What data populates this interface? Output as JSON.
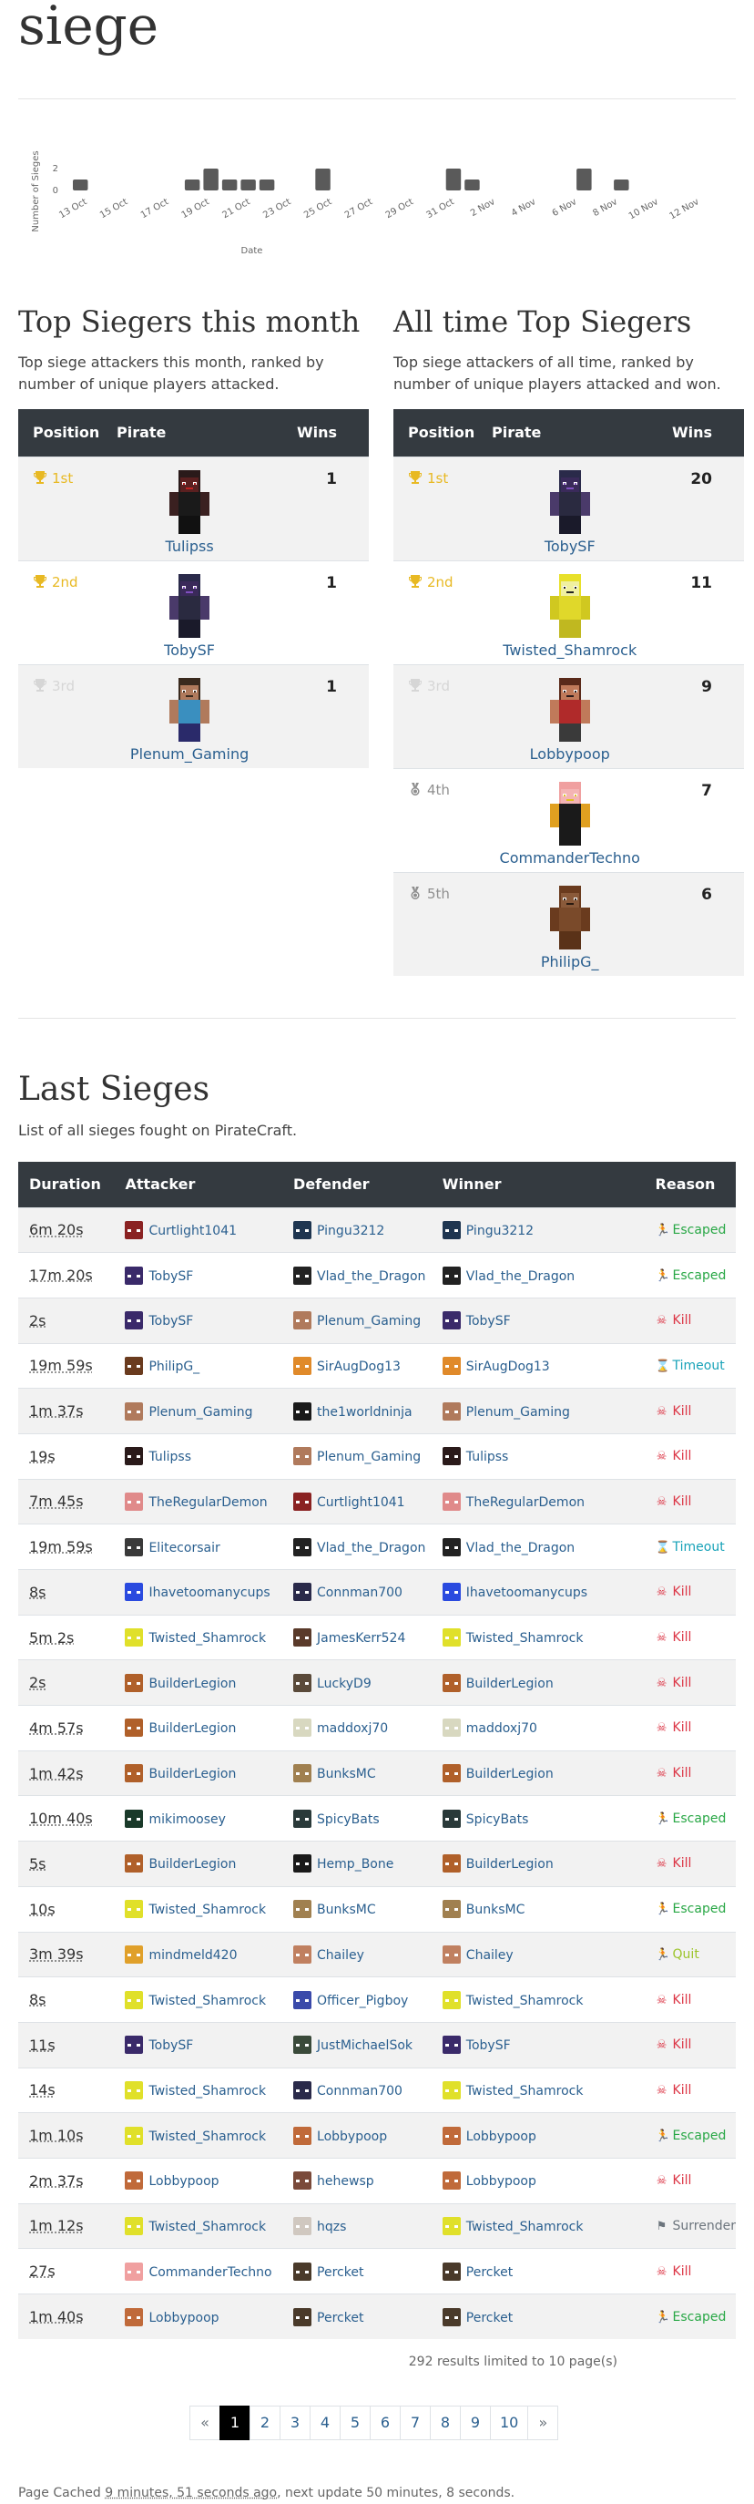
{
  "page_title": "siege",
  "chart_data": {
    "type": "bar",
    "xlabel": "Date",
    "ylabel": "Number of Sieges",
    "ylim": [
      0,
      2
    ],
    "yticks": [
      0,
      2
    ],
    "tick_labels": [
      "13 Oct",
      "15 Oct",
      "17 Oct",
      "19 Oct",
      "21 Oct",
      "23 Oct",
      "25 Oct",
      "27 Oct",
      "29 Oct",
      "31 Oct",
      "2 Nov",
      "4 Nov",
      "6 Nov",
      "8 Nov",
      "10 Nov",
      "12 Nov"
    ],
    "categories": [
      "13 Oct",
      "14 Oct",
      "15 Oct",
      "16 Oct",
      "17 Oct",
      "18 Oct",
      "19 Oct",
      "20 Oct",
      "21 Oct",
      "22 Oct",
      "23 Oct",
      "24 Oct",
      "25 Oct",
      "26 Oct",
      "27 Oct",
      "28 Oct",
      "29 Oct",
      "30 Oct",
      "31 Oct",
      "1 Nov",
      "2 Nov",
      "3 Nov",
      "4 Nov",
      "5 Nov",
      "6 Nov",
      "7 Nov",
      "8 Nov",
      "9 Nov",
      "10 Nov",
      "11 Nov",
      "12 Nov"
    ],
    "values": [
      1,
      0,
      0,
      0,
      0,
      0,
      1,
      2,
      1,
      1,
      1,
      0,
      0,
      2,
      0,
      0,
      0,
      0,
      0,
      0,
      2,
      1,
      0,
      0,
      0,
      0,
      0,
      2,
      0,
      1,
      0,
      0,
      0,
      0,
      0
    ],
    "bar_color": "#5a5a5a"
  },
  "this_month": {
    "title": "Top Siegers this month",
    "description": "Top siege attackers this month, ranked by number of unique players attacked.",
    "headers": {
      "position": "Position",
      "pirate": "Pirate",
      "wins": "Wins"
    },
    "rows": [
      {
        "rank": "1st",
        "tier": "gold",
        "name": "Tulipss",
        "wins": "1",
        "skin": "dark-armor"
      },
      {
        "rank": "2nd",
        "tier": "gold",
        "name": "TobySF",
        "wins": "1",
        "skin": "dark-armor-blue"
      },
      {
        "rank": "3rd",
        "tier": "silver",
        "name": "Plenum_Gaming",
        "wins": "1",
        "skin": "steve"
      }
    ]
  },
  "all_time": {
    "title": "All time Top Siegers",
    "description": "Top siege attackers of all time, ranked by number of unique players attacked and won.",
    "headers": {
      "position": "Position",
      "pirate": "Pirate",
      "wins": "Wins"
    },
    "rows": [
      {
        "rank": "1st",
        "tier": "gold",
        "name": "TobySF",
        "wins": "20",
        "skin": "dark-armor-blue"
      },
      {
        "rank": "2nd",
        "tier": "gold",
        "name": "Twisted_Shamrock",
        "wins": "11",
        "skin": "yellow"
      },
      {
        "rank": "3rd",
        "tier": "silver",
        "name": "Lobbypoop",
        "wins": "9",
        "skin": "red-shirt"
      },
      {
        "rank": "4th",
        "tier": "bronze",
        "name": "CommanderTechno",
        "wins": "7",
        "skin": "pig-suit"
      },
      {
        "rank": "5th",
        "tier": "bronze",
        "name": "PhilipG_",
        "wins": "6",
        "skin": "brown-bear"
      }
    ]
  },
  "last_sieges": {
    "title": "Last Sieges",
    "description": "List of all sieges fought on PirateCraft.",
    "headers": {
      "duration": "Duration",
      "attacker": "Attacker",
      "defender": "Defender",
      "winner": "Winner",
      "reason": "Reason"
    },
    "rows": [
      {
        "duration": "6m 20s",
        "attacker": "Curtlight1041",
        "defender": "Pingu3212",
        "winner": "Pingu3212",
        "reason": "Escaped",
        "ac": "#8a2222",
        "dc": "#1e3550",
        "wc": "#1e3550"
      },
      {
        "duration": "17m 20s",
        "attacker": "TobySF",
        "defender": "Vlad_the_Dragon",
        "winner": "Vlad_the_Dragon",
        "reason": "Escaped",
        "ac": "#3a2a6a",
        "dc": "#222222",
        "wc": "#222222"
      },
      {
        "duration": "2s",
        "attacker": "TobySF",
        "defender": "Plenum_Gaming",
        "winner": "TobySF",
        "reason": "Kill",
        "ac": "#3a2a6a",
        "dc": "#b07a5c",
        "wc": "#3a2a6a"
      },
      {
        "duration": "19m 59s",
        "attacker": "PhilipG_",
        "defender": "SirAugDog13",
        "winner": "SirAugDog13",
        "reason": "Timeout",
        "ac": "#6a3b1e",
        "dc": "#e08a2a",
        "wc": "#e08a2a"
      },
      {
        "duration": "1m 37s",
        "attacker": "Plenum_Gaming",
        "defender": "the1worldninja",
        "winner": "Plenum_Gaming",
        "reason": "Kill",
        "ac": "#b07a5c",
        "dc": "#1a1a1a",
        "wc": "#b07a5c"
      },
      {
        "duration": "19s",
        "attacker": "Tulipss",
        "defender": "Plenum_Gaming",
        "winner": "Tulipss",
        "reason": "Kill",
        "ac": "#2a1a1a",
        "dc": "#b07a5c",
        "wc": "#2a1a1a"
      },
      {
        "duration": "7m 45s",
        "attacker": "TheRegularDemon",
        "defender": "Curtlight1041",
        "winner": "TheRegularDemon",
        "reason": "Kill",
        "ac": "#e08a8a",
        "dc": "#8a2222",
        "wc": "#e08a8a"
      },
      {
        "duration": "19m 59s",
        "attacker": "Elitecorsair",
        "defender": "Vlad_the_Dragon",
        "winner": "Vlad_the_Dragon",
        "reason": "Timeout",
        "ac": "#3a3a3a",
        "dc": "#222222",
        "wc": "#222222"
      },
      {
        "duration": "8s",
        "attacker": "Ihavetoomanycups",
        "defender": "Connman700",
        "winner": "Ihavetoomanycups",
        "reason": "Kill",
        "ac": "#2a4adf",
        "dc": "#2a2a4a",
        "wc": "#2a4adf"
      },
      {
        "duration": "5m 2s",
        "attacker": "Twisted_Shamrock",
        "defender": "JamesKerr524",
        "winner": "Twisted_Shamrock",
        "reason": "Kill",
        "ac": "#e0e02a",
        "dc": "#5a3a2a",
        "wc": "#e0e02a"
      },
      {
        "duration": "2s",
        "attacker": "BuilderLegion",
        "defender": "LuckyD9",
        "winner": "BuilderLegion",
        "reason": "Kill",
        "ac": "#b0602a",
        "dc": "#5a4a3a",
        "wc": "#b0602a"
      },
      {
        "duration": "4m 57s",
        "attacker": "BuilderLegion",
        "defender": "maddoxj70",
        "winner": "maddoxj70",
        "reason": "Kill",
        "ac": "#b0602a",
        "dc": "#d8d8c0",
        "wc": "#d8d8c0"
      },
      {
        "duration": "1m 42s",
        "attacker": "BuilderLegion",
        "defender": "BunksMC",
        "winner": "BuilderLegion",
        "reason": "Kill",
        "ac": "#b0602a",
        "dc": "#a08050",
        "wc": "#b0602a"
      },
      {
        "duration": "10m 40s",
        "attacker": "mikimoosey",
        "defender": "SpicyBats",
        "winner": "SpicyBats",
        "reason": "Escaped",
        "ac": "#1a3a2a",
        "dc": "#2a3a3a",
        "wc": "#2a3a3a"
      },
      {
        "duration": "5s",
        "attacker": "BuilderLegion",
        "defender": "Hemp_Bone",
        "winner": "BuilderLegion",
        "reason": "Kill",
        "ac": "#b0602a",
        "dc": "#1a1a1a",
        "wc": "#b0602a"
      },
      {
        "duration": "10s",
        "attacker": "Twisted_Shamrock",
        "defender": "BunksMC",
        "winner": "BunksMC",
        "reason": "Escaped",
        "ac": "#e0e02a",
        "dc": "#a08050",
        "wc": "#a08050"
      },
      {
        "duration": "3m 39s",
        "attacker": "mindmeld420",
        "defender": "Chailey",
        "winner": "Chailey",
        "reason": "Quit",
        "ac": "#e0a02a",
        "dc": "#c08060",
        "wc": "#c08060"
      },
      {
        "duration": "8s",
        "attacker": "Twisted_Shamrock",
        "defender": "Officer_Pigboy",
        "winner": "Twisted_Shamrock",
        "reason": "Kill",
        "ac": "#e0e02a",
        "dc": "#3a4aaa",
        "wc": "#e0e02a"
      },
      {
        "duration": "11s",
        "attacker": "TobySF",
        "defender": "JustMichaelSok",
        "winner": "TobySF",
        "reason": "Kill",
        "ac": "#3a2a6a",
        "dc": "#3a4a3a",
        "wc": "#3a2a6a"
      },
      {
        "duration": "14s",
        "attacker": "Twisted_Shamrock",
        "defender": "Connman700",
        "winner": "Twisted_Shamrock",
        "reason": "Kill",
        "ac": "#e0e02a",
        "dc": "#2a2a4a",
        "wc": "#e0e02a"
      },
      {
        "duration": "1m 10s",
        "attacker": "Twisted_Shamrock",
        "defender": "Lobbypoop",
        "winner": "Lobbypoop",
        "reason": "Escaped",
        "ac": "#e0e02a",
        "dc": "#c06a3a",
        "wc": "#c06a3a"
      },
      {
        "duration": "2m 37s",
        "attacker": "Lobbypoop",
        "defender": "hehewsp",
        "winner": "Lobbypoop",
        "reason": "Kill",
        "ac": "#c06a3a",
        "dc": "#7a4a3a",
        "wc": "#c06a3a"
      },
      {
        "duration": "1m 12s",
        "attacker": "Twisted_Shamrock",
        "defender": "hqzs",
        "winner": "Twisted_Shamrock",
        "reason": "Surrender",
        "ac": "#e0e02a",
        "dc": "#d0c8c0",
        "wc": "#e0e02a"
      },
      {
        "duration": "27s",
        "attacker": "CommanderTechno",
        "defender": "Percket",
        "winner": "Percket",
        "reason": "Kill",
        "ac": "#f0a0a0",
        "dc": "#4a3a2a",
        "wc": "#4a3a2a"
      },
      {
        "duration": "1m 40s",
        "attacker": "Lobbypoop",
        "defender": "Percket",
        "winner": "Percket",
        "reason": "Escaped",
        "ac": "#c06a3a",
        "dc": "#4a3a2a",
        "wc": "#4a3a2a"
      }
    ]
  },
  "results_note": "292 results limited to 10 page(s)",
  "pagination": {
    "prev": "«",
    "pages": [
      "1",
      "2",
      "3",
      "4",
      "5",
      "6",
      "7",
      "8",
      "9",
      "10"
    ],
    "active": "1",
    "next": "»"
  },
  "cache_note": {
    "prefix": "Page Cached ",
    "age": "9 minutes, 51 seconds ago",
    "suffix": ", next update 50 minutes, 8 seconds."
  },
  "reason_styles": {
    "Escaped": {
      "color": "#28a745",
      "icon": "🏃"
    },
    "Kill": {
      "color": "#dc3545",
      "icon": "☠"
    },
    "Timeout": {
      "color": "#17a2b8",
      "icon": "⌛"
    },
    "Quit": {
      "color": "#9cc42a",
      "icon": "🏃"
    },
    "Surrender": {
      "color": "#6c757d",
      "icon": "⚑"
    }
  },
  "tier_colors": {
    "gold": "#e8b923",
    "silver": "#d6d6d6",
    "bronze": "#8f8f8f"
  }
}
